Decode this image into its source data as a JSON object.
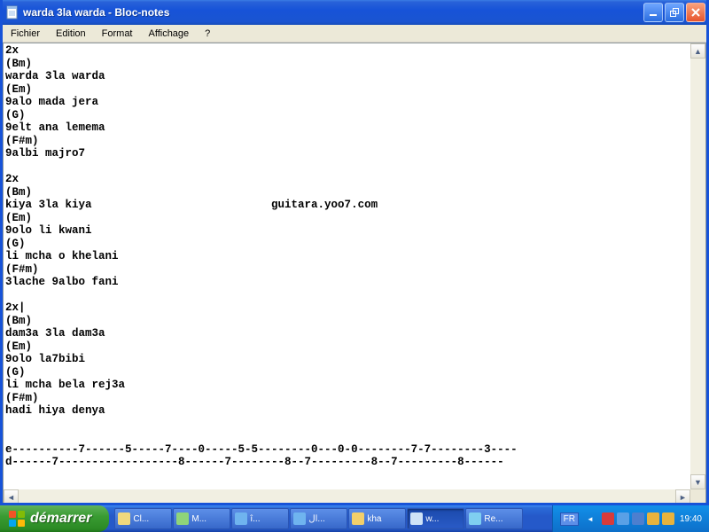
{
  "window": {
    "title": "warda 3la warda - Bloc-notes"
  },
  "menu": {
    "file": "Fichier",
    "edit": "Edition",
    "format": "Format",
    "view": "Affichage",
    "help": "?"
  },
  "document": {
    "content": "2x\n(Bm)\nwarda 3la warda\n(Em)\n9alo mada jera\n(G)\n9elt ana lemema\n(F#m)\n9albi majro7\n\n2x\n(Bm)\nkiya 3la kiya                           guitara.yoo7.com\n(Em)\n9olo li kwani\n(G)\nli mcha o khelani\n(F#m)\n3lache 9albo fani\n\n2x|\n(Bm)\ndam3a 3la dam3a\n(Em)\n9olo la7bibi\n(G)\nli mcha bela rej3a\n(F#m)\nhadi hiya denya\n\n\ne----------7------5-----7----0-----5-5--------0---0-0--------7-7--------3----\nd------7------------------8------7--------8--7---------8--7---------8------"
  },
  "taskbar": {
    "start": "démarrer",
    "items": [
      {
        "label": "Cl..."
      },
      {
        "label": "M..."
      },
      {
        "label": "î..."
      },
      {
        "label": "ال..."
      },
      {
        "label": "kha"
      },
      {
        "label": "w..."
      },
      {
        "label": "Re..."
      }
    ],
    "lang": "FR",
    "clock": "19:40"
  }
}
